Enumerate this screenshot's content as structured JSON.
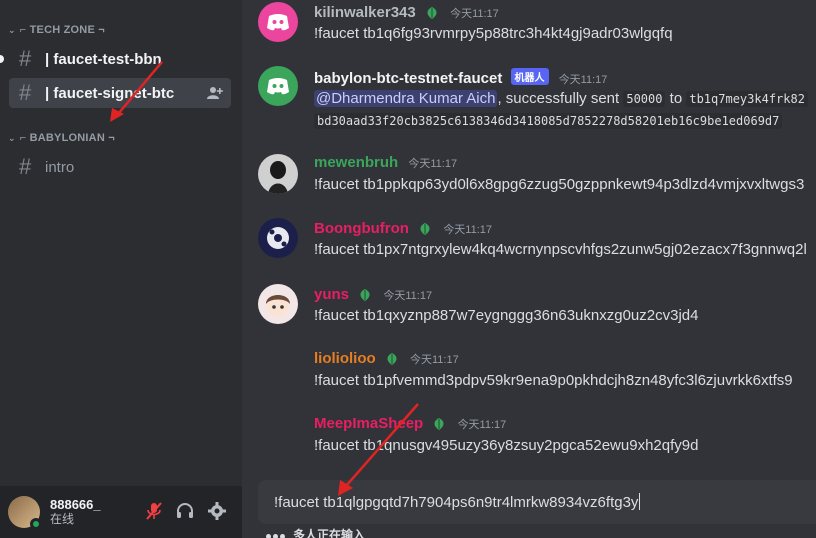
{
  "sidebar": {
    "categories": [
      {
        "label": "⌐ TECH ZONE ¬"
      },
      {
        "label": "⌐ BABYLONIAN ¬"
      }
    ],
    "channels": [
      {
        "label": "| faucet-test-bbn"
      },
      {
        "label": "| faucet-signet-btc"
      },
      {
        "label": "intro"
      }
    ]
  },
  "user": {
    "name": "888666_",
    "status": "在线"
  },
  "messages": [
    {
      "author": "kilinwalker343",
      "time": "今天11:17",
      "text": "!faucet tb1q6fg93rvmrpy5p88trc3h4kt4gj9adr03wlgqfq",
      "color": "#b5bac1"
    },
    {
      "author": "babylon-btc-testnet-faucet",
      "badge": "机器人",
      "time": "今天11:17",
      "mention": "@Dharmendra Kumar Aich",
      "text_mid": ", successfully sent ",
      "amount": "50000",
      "to": " to ",
      "addr": "tb1q7mey3k4frk82",
      "txid": "bd30aad33f20cb3825c6138346d3418085d7852278d58201eb16c9be1ed069d7",
      "color": "#f2f3f5"
    },
    {
      "author": "mewenbruh",
      "time": "今天11:17",
      "text": "!faucet tb1ppkqp63yd0l6x8gpg6zzug50gzppnkewt94p3dlzd4vmjxvxltwgs3",
      "color": "#3ba55c"
    },
    {
      "author": "Boongbufron",
      "time": "今天11:17",
      "text": "!faucet tb1px7ntgrxylew4kq4wcrnynpscvhfgs2zunw5gj02ezacx7f3gnnwq2l",
      "color": "#e91e63"
    },
    {
      "author": "yuns",
      "time": "今天11:17",
      "text": "!faucet tb1qxyznp887w7eygnggg36n63uknxzg0uz2cv3jd4",
      "color": "#e91e63"
    },
    {
      "author": "lioliolioo",
      "time": "今天11:17",
      "text": "!faucet tb1pfvemmd3pdpv59kr9ena9p0pkhdcjh8zn48yfc3l6zjuvrkk6xtfs9",
      "color": "#e67e22"
    },
    {
      "author": "MeepImaSheep",
      "time": "今天11:17",
      "text": "!faucet tb1qnusgv495uzy36y8zsuy2pgca52ewu9xh2qfy9d",
      "color": "#e91e63"
    }
  ],
  "composer": {
    "value": "!faucet tb1qlgpgqtd7h7904ps6n9tr4lmrkw8934vz6ftg3y"
  },
  "typing": {
    "text": "多人正在输入"
  },
  "colors": {
    "annotation_arrow": "#e02424"
  }
}
